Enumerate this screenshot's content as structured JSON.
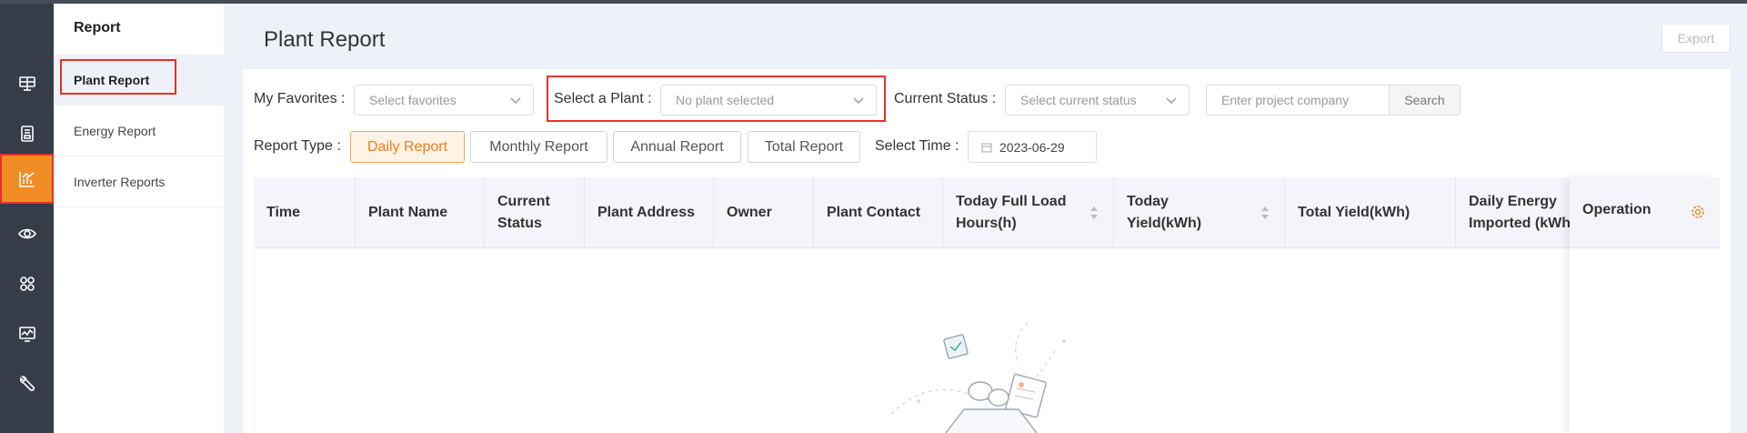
{
  "nav_icons": [
    "dashboard-icon",
    "device-icon",
    "report-icon",
    "monitor-eye-icon",
    "apps-icon",
    "chart-monitor-icon",
    "tools-icon"
  ],
  "submenu": {
    "title": "Report",
    "items": [
      {
        "label": "Plant Report",
        "active": true
      },
      {
        "label": "Energy Report",
        "active": false
      },
      {
        "label": "Inverter Reports",
        "active": false
      }
    ]
  },
  "page": {
    "title": "Plant Report",
    "export_label": "Export"
  },
  "filters": {
    "favorites_label": "My Favorites :",
    "favorites_placeholder": "Select favorites",
    "plant_label": "Select a Plant :",
    "plant_placeholder": "No plant selected",
    "status_label": "Current Status :",
    "status_placeholder": "Select current status",
    "company_placeholder": "Enter project company",
    "search_label": "Search",
    "report_type_label": "Report Type :",
    "report_types": [
      "Daily Report",
      "Monthly Report",
      "Annual Report",
      "Total Report"
    ],
    "active_report_type": "Daily Report",
    "select_time_label": "Select Time :",
    "select_time_value": "2023-06-29"
  },
  "table": {
    "columns": [
      {
        "label": "Time"
      },
      {
        "label": "Plant Name"
      },
      {
        "label": "Current\nStatus"
      },
      {
        "label": "Plant Address"
      },
      {
        "label": "Owner"
      },
      {
        "label": "Plant Contact"
      },
      {
        "label": "Today Full Load\nHours(h)",
        "sortable": true
      },
      {
        "label": "Today\nYield(kWh)",
        "sortable": true
      },
      {
        "label": "Total Yield(kWh)"
      },
      {
        "label": "Daily Energy\nImported (kWh)"
      }
    ],
    "operation_label": "Operation",
    "rows": []
  },
  "colors": {
    "accent": "#f08d24",
    "highlight_border": "#e6312c",
    "sidebar_bg": "#363c48"
  }
}
